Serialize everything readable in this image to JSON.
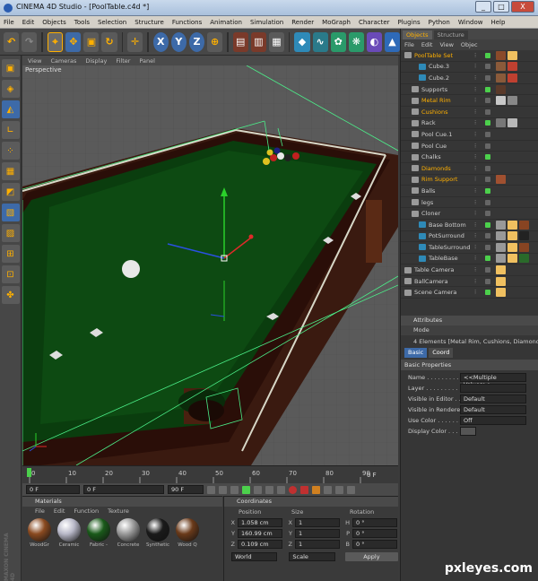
{
  "window": {
    "title": "CINEMA 4D Studio - [PoolTable.c4d *]",
    "controls": [
      "_",
      "□",
      "X"
    ]
  },
  "menubar": [
    "File",
    "Edit",
    "Objects",
    "Tools",
    "Selection",
    "Structure",
    "Functions",
    "Animation",
    "Simulation",
    "Render",
    "MoGraph",
    "Character",
    "Plugins",
    "Python",
    "Window",
    "Help"
  ],
  "toolbar": {
    "icons": [
      "undo-icon",
      "redo-icon",
      "select-icon",
      "move-icon",
      "scale-icon",
      "rotate-icon",
      "add-icon",
      "x-axis-icon",
      "y-axis-icon",
      "z-axis-icon",
      "world-icon",
      "render-view-icon",
      "render-picture-icon",
      "render-settings-icon",
      "cube-icon",
      "spline-icon",
      "nurbs-icon",
      "array-icon",
      "deformer-icon",
      "scene-icon",
      "camera-icon",
      "light-icon"
    ],
    "axis_labels": {
      "x": "X",
      "y": "Y",
      "z": "Z"
    }
  },
  "viewport": {
    "menu": [
      "View",
      "Cameras",
      "Display",
      "Filter",
      "Panel"
    ],
    "label": "Perspective"
  },
  "timeline": {
    "ticks": [
      "0",
      "10",
      "20",
      "30",
      "40",
      "50",
      "60",
      "70",
      "80",
      "90"
    ],
    "end_frame": "0 F",
    "current": "0 F",
    "start": "0 F",
    "end": "90 F",
    "fps": "90 F"
  },
  "objects_panel": {
    "tabs": [
      "Objects",
      "Structure"
    ],
    "menu": [
      "File",
      "Edit",
      "View",
      "Objec"
    ],
    "items": [
      {
        "name": "PoolTable Set",
        "indent": 0,
        "color": "#ffb000",
        "tags": [
          "#8a4a2a",
          "#f0c060"
        ]
      },
      {
        "name": "Cube.3",
        "indent": 2,
        "color": "#cfcfcf",
        "tags": [
          "#8a5a3a",
          "#c04030"
        ]
      },
      {
        "name": "Cube.2",
        "indent": 2,
        "color": "#cfcfcf",
        "tags": [
          "#8a5a3a",
          "#c04030"
        ]
      },
      {
        "name": "Supports",
        "indent": 1,
        "color": "#cfcfcf",
        "tags": [
          "#5a3a2a"
        ]
      },
      {
        "name": "Metal Rim",
        "indent": 1,
        "color": "#ffb000",
        "tags": [
          "#c8c8c8",
          "#888888"
        ]
      },
      {
        "name": "Cushions",
        "indent": 1,
        "color": "#ffb000",
        "tags": []
      },
      {
        "name": "Rack",
        "indent": 1,
        "color": "#cfcfcf",
        "tags": [
          "#777777",
          "#b8b8b8"
        ]
      },
      {
        "name": "Pool Cue.1",
        "indent": 1,
        "color": "#cfcfcf",
        "tags": []
      },
      {
        "name": "Pool Cue",
        "indent": 1,
        "color": "#cfcfcf",
        "tags": []
      },
      {
        "name": "Chalks",
        "indent": 1,
        "color": "#cfcfcf",
        "tags": []
      },
      {
        "name": "Diamonds",
        "indent": 1,
        "color": "#ffb000",
        "tags": []
      },
      {
        "name": "Rim Support",
        "indent": 1,
        "color": "#ffb000",
        "tags": [
          "#a05030"
        ]
      },
      {
        "name": "Balls",
        "indent": 1,
        "color": "#cfcfcf",
        "tags": []
      },
      {
        "name": "legs",
        "indent": 1,
        "color": "#cfcfcf",
        "tags": []
      },
      {
        "name": "Cloner",
        "indent": 1,
        "color": "#cfcfcf",
        "tags": []
      },
      {
        "name": "Base Bottom",
        "indent": 2,
        "color": "#cfcfcf",
        "tags": [
          "#999999",
          "#f0c060",
          "#884422"
        ]
      },
      {
        "name": "PotSurround",
        "indent": 2,
        "color": "#cfcfcf",
        "tags": [
          "#999999",
          "#f0c060",
          "#222222"
        ]
      },
      {
        "name": "TableSurround",
        "indent": 2,
        "color": "#cfcfcf",
        "tags": [
          "#999999",
          "#f0c060",
          "#884422"
        ]
      },
      {
        "name": "TableBase",
        "indent": 2,
        "color": "#cfcfcf",
        "tags": [
          "#999999",
          "#f0c060",
          "#2a6a2a"
        ]
      },
      {
        "name": "Table Camera",
        "indent": 0,
        "color": "#cfcfcf",
        "tags": [
          "#f0c060"
        ]
      },
      {
        "name": "BallCamera",
        "indent": 0,
        "color": "#cfcfcf",
        "tags": [
          "#f0c060"
        ]
      },
      {
        "name": "Scene Camera",
        "indent": 0,
        "color": "#cfcfcf",
        "tags": [
          "#f0c060"
        ]
      }
    ]
  },
  "attributes_panel": {
    "title": "Attributes",
    "mode": "Mode",
    "selection": "4 Elements [Metal Rim, Cushions, Diamonds, R",
    "tabs": [
      "Basic",
      "Coord"
    ],
    "section": "Basic Properties",
    "fields": [
      {
        "key": "Name . . . . . . . . .",
        "value": "<<Multiple Values>>"
      },
      {
        "key": "Layer . . . . . . . . .",
        "value": ""
      },
      {
        "key": "Visible in Editor . .",
        "value": "Default"
      },
      {
        "key": "Visible in Renderer",
        "value": "Default"
      },
      {
        "key": "Use Color . . . . . .",
        "value": "Off"
      },
      {
        "key": "Display Color . . .",
        "value": ""
      }
    ]
  },
  "materials_panel": {
    "title": "Materials",
    "menu": [
      "File",
      "Edit",
      "Function",
      "Texture"
    ],
    "materials": [
      {
        "name": "WoodGr",
        "color": "#8a4a20"
      },
      {
        "name": "Ceramic",
        "color": "#b8b8c8"
      },
      {
        "name": "Fabric -",
        "color": "#1a5a1a"
      },
      {
        "name": "Concrete",
        "color": "#9a9a9a"
      },
      {
        "name": "Synthetic",
        "color": "#1a1a1a"
      },
      {
        "name": "Wood Q",
        "color": "#6a3a1a"
      }
    ]
  },
  "coordinates_panel": {
    "title": "Coordinates",
    "headers": [
      "Position",
      "Size",
      "Rotation"
    ],
    "rows": [
      {
        "axis": "X",
        "pos": "1.058 cm",
        "size_axis": "X",
        "size": "1",
        "rot_axis": "H",
        "rot": "0 °"
      },
      {
        "axis": "Y",
        "pos": "160.99 cm",
        "size_axis": "Y",
        "size": "1",
        "rot_axis": "P",
        "rot": "0 °"
      },
      {
        "axis": "Z",
        "pos": "0.109 cm",
        "size_axis": "Z",
        "size": "1",
        "rot_axis": "B",
        "rot": "0 °"
      }
    ],
    "mode": "World",
    "scale": "Scale",
    "apply": "Apply"
  },
  "maxon_logo": "MAXON CINEMA 4D",
  "watermark": "pxleyes.com"
}
